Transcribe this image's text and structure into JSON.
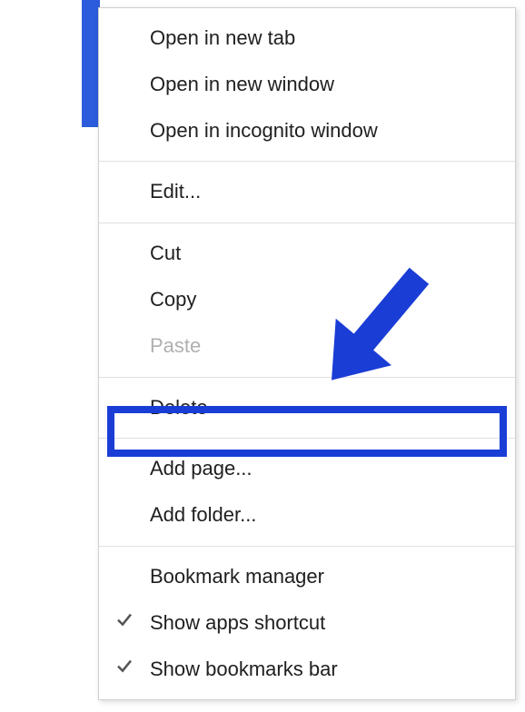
{
  "menu": {
    "sections": [
      {
        "items": [
          {
            "label": "Open in new tab",
            "disabled": false,
            "checked": false
          },
          {
            "label": "Open in new window",
            "disabled": false,
            "checked": false
          },
          {
            "label": "Open in incognito window",
            "disabled": false,
            "checked": false
          }
        ]
      },
      {
        "items": [
          {
            "label": "Edit...",
            "disabled": false,
            "checked": false
          }
        ]
      },
      {
        "items": [
          {
            "label": "Cut",
            "disabled": false,
            "checked": false
          },
          {
            "label": "Copy",
            "disabled": false,
            "checked": false
          },
          {
            "label": "Paste",
            "disabled": true,
            "checked": false
          }
        ]
      },
      {
        "items": [
          {
            "label": "Delete",
            "disabled": false,
            "checked": false
          }
        ]
      },
      {
        "items": [
          {
            "label": "Add page...",
            "disabled": false,
            "checked": false,
            "highlighted": true
          },
          {
            "label": "Add folder...",
            "disabled": false,
            "checked": false
          }
        ]
      },
      {
        "items": [
          {
            "label": "Bookmark manager",
            "disabled": false,
            "checked": false
          },
          {
            "label": "Show apps shortcut",
            "disabled": false,
            "checked": true
          },
          {
            "label": "Show bookmarks bar",
            "disabled": false,
            "checked": true
          }
        ]
      }
    ]
  },
  "annotation": {
    "arrow_color": "#1a3dd6",
    "highlight_color": "#1a3dd6"
  }
}
